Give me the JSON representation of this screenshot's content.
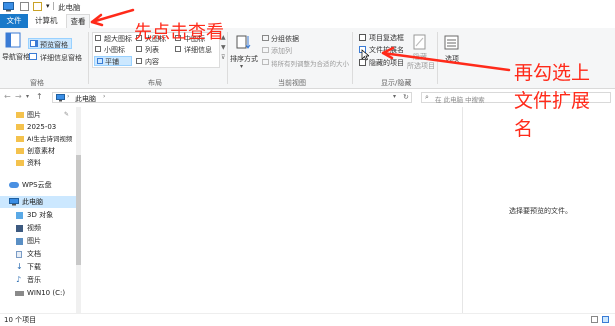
{
  "window": {
    "title": "此电脑"
  },
  "tabs": [
    {
      "label": "文件",
      "selected": false
    },
    {
      "label": "计算机",
      "selected": false
    },
    {
      "label": "查看",
      "selected": true
    }
  ],
  "ribbon": {
    "pane_group": {
      "label": "窗格",
      "nav_pane": "导航窗格",
      "preview_pane": "预览窗格",
      "details_pane": "详细信息窗格"
    },
    "layout_group": {
      "label": "布局",
      "items": [
        "超大图标",
        "大图标",
        "中图标",
        "小图标",
        "列表",
        "详细信息",
        "平铺",
        "内容"
      ],
      "selected": "平铺"
    },
    "current_view_group": {
      "label": "当前视图",
      "sort": "排序方式",
      "group_by": "分组依据",
      "add_column": "添加列",
      "size_all_columns": "将所有列调整为合适的大小"
    },
    "show_hide_group": {
      "label": "显示/隐藏",
      "item_checkboxes": "项目复选框",
      "file_name_extensions": "文件扩展名",
      "hidden_items": "隐藏的项目",
      "hide_selected": "隐藏",
      "hide_selected_2": "所选项目"
    },
    "options": "选项"
  },
  "address": {
    "breadcrumb": "此电脑",
    "search_placeholder": "在 此电脑 中搜索"
  },
  "nav": {
    "items": [
      {
        "label": "图片",
        "pinned": true
      },
      {
        "label": "2025-03"
      },
      {
        "label": "AI生古诗词视频"
      },
      {
        "label": "创意素材"
      },
      {
        "label": "资料"
      },
      {
        "label": "WPS云盘"
      },
      {
        "label": "此电脑",
        "selected": true
      },
      {
        "label": "3D 对象"
      },
      {
        "label": "视频"
      },
      {
        "label": "图片"
      },
      {
        "label": "文档"
      },
      {
        "label": "下载"
      },
      {
        "label": "音乐"
      },
      {
        "label": "WIN10 (C:)"
      }
    ]
  },
  "preview": {
    "empty_text": "选择要预览的文件。"
  },
  "status": {
    "item_count": "10 个项目"
  },
  "annotations": {
    "step1": "先点击查看",
    "step2_line1": "再勾选上",
    "step2_line2": "文件扩展",
    "step2_line3": "名"
  },
  "colors": {
    "accent": "#1979ca",
    "annotation": "#ff2a1a",
    "selection": "#cce8ff"
  }
}
